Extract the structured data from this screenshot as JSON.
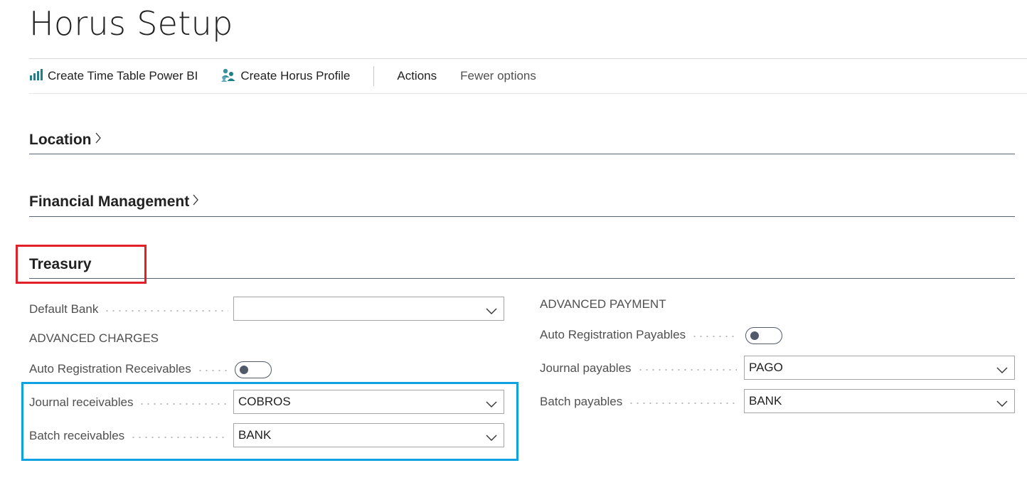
{
  "page": {
    "title": "Horus Setup"
  },
  "toolbar": {
    "create_time_table_label": "Create Time Table Power BI",
    "create_profile_label": "Create Horus Profile",
    "actions_label": "Actions",
    "fewer_options_label": "Fewer options"
  },
  "sections": {
    "location": {
      "title": "Location"
    },
    "financial": {
      "title": "Financial Management"
    },
    "treasury": {
      "title": "Treasury"
    }
  },
  "treasury": {
    "default_bank": {
      "label": "Default Bank",
      "value": ""
    },
    "advanced_charges": {
      "heading": "ADVANCED CHARGES",
      "auto_registration_receivables": {
        "label": "Auto Registration Receivables",
        "on": false
      },
      "journal_receivables": {
        "label": "Journal receivables",
        "value": "COBROS"
      },
      "batch_receivables": {
        "label": "Batch receivables",
        "value": "BANK"
      }
    },
    "advanced_payment": {
      "heading": "ADVANCED PAYMENT",
      "auto_registration_payables": {
        "label": "Auto Registration Payables",
        "on": false
      },
      "journal_payables": {
        "label": "Journal payables",
        "value": "PAGO"
      },
      "batch_payables": {
        "label": "Batch payables",
        "value": "BANK"
      }
    }
  },
  "colors": {
    "highlight_red": "#e3202a",
    "highlight_blue": "#0ea3e0",
    "icon_teal": "#1e7f86"
  },
  "icons": [
    "bar-chart-icon",
    "people-icon",
    "chevron-right-icon",
    "chevron-down-icon"
  ]
}
